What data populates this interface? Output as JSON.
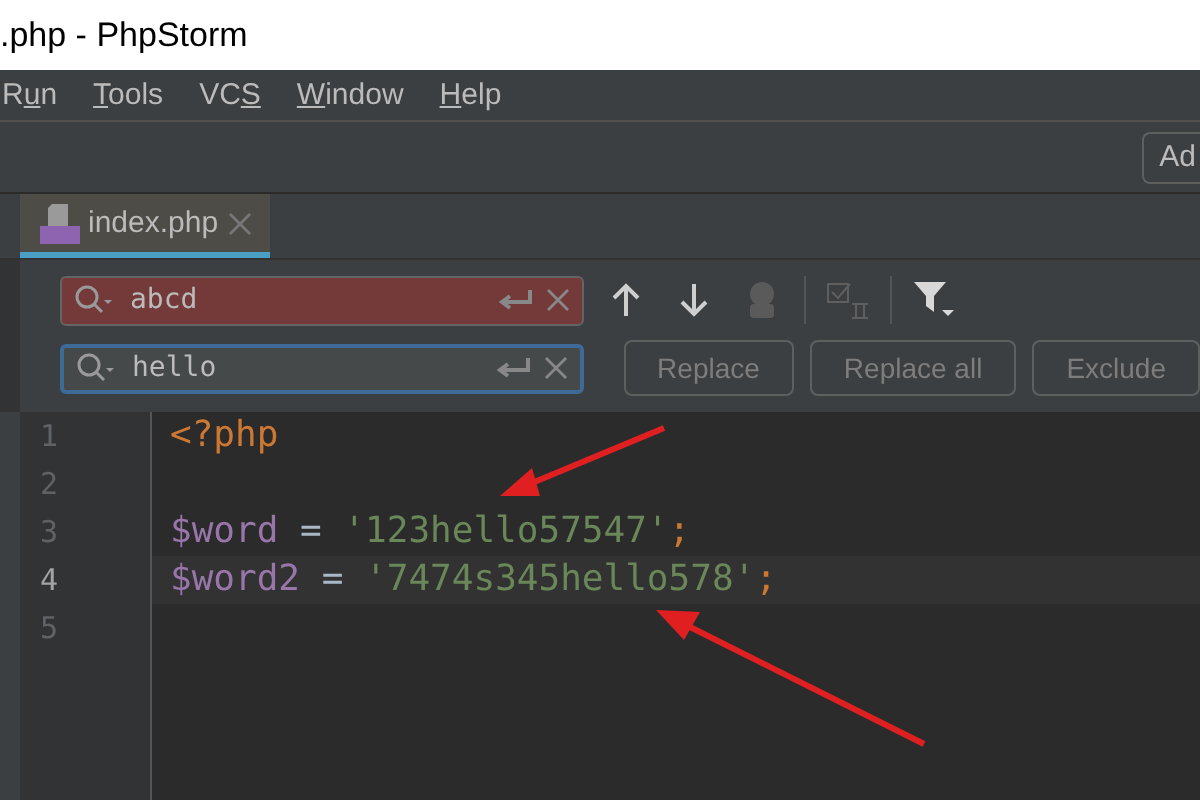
{
  "window": {
    "title": ".php - PhpStorm"
  },
  "menu": [
    {
      "before": "R",
      "key": "u",
      "after": "n"
    },
    {
      "key": "T",
      "after": "ools"
    },
    {
      "before": "VC",
      "key": "S"
    },
    {
      "key": "W",
      "after": "indow"
    },
    {
      "key": "H",
      "after": "elp"
    }
  ],
  "toolbar": {
    "button": "Ad"
  },
  "tabs": [
    {
      "label": "index.php",
      "selected": true
    }
  ],
  "find": {
    "search": {
      "value": "abcd",
      "no_match": true,
      "focused": false
    },
    "replace": {
      "value": "hello",
      "no_match": false,
      "focused": true
    },
    "buttons": [
      {
        "label": "Replace"
      },
      {
        "label": "Replace all"
      },
      {
        "label": "Exclude"
      }
    ]
  },
  "editor": {
    "lines": [
      {
        "number": "1",
        "current": false,
        "tokens": [
          {
            "kind": "tag",
            "text": "<?php"
          }
        ]
      },
      {
        "number": "2",
        "current": false
      },
      {
        "number": "3",
        "current": false,
        "tokens": [
          {
            "kind": "var",
            "text": "$word"
          },
          {
            "kind": "op",
            "text": " = "
          },
          {
            "kind": "str",
            "text": "'123hello57547'"
          },
          {
            "kind": "punct",
            "text": ";"
          }
        ]
      },
      {
        "number": "4",
        "current": true,
        "tokens": [
          {
            "kind": "var",
            "text": "$word2"
          },
          {
            "kind": "op",
            "text": " = "
          },
          {
            "kind": "str",
            "text": "'7474s345hello578'"
          },
          {
            "kind": "punct",
            "text": ";"
          }
        ]
      },
      {
        "number": "5",
        "current": false
      }
    ]
  }
}
